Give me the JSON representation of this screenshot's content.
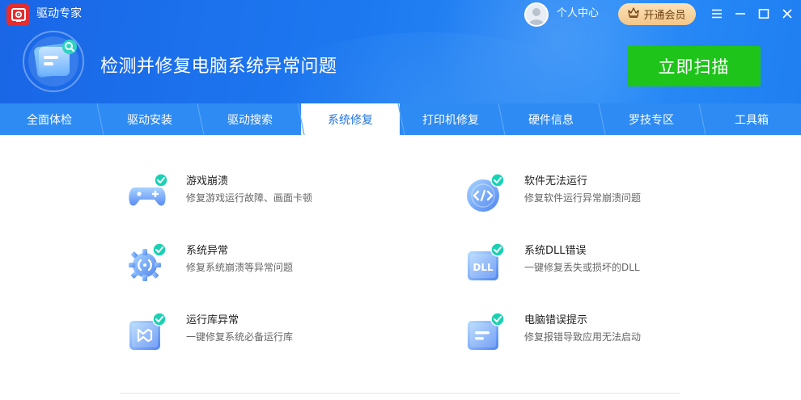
{
  "app": {
    "title": "驱动专家"
  },
  "header": {
    "user_center": "个人中心",
    "vip_label": "开通会员",
    "hero_title": "检测并修复电脑系统异常问题",
    "scan_button": "立即扫描"
  },
  "window_controls": [
    "menu-icon",
    "minimize-icon",
    "maximize-icon",
    "close-icon"
  ],
  "tabs": [
    {
      "label": "全面体检"
    },
    {
      "label": "驱动安装"
    },
    {
      "label": "驱动搜索"
    },
    {
      "label": "系统修复",
      "active": true
    },
    {
      "label": "打印机修复"
    },
    {
      "label": "硬件信息"
    },
    {
      "label": "罗技专区"
    },
    {
      "label": "工具箱"
    }
  ],
  "repair_items": [
    {
      "title": "游戏崩溃",
      "desc": "修复游戏运行故障、画面卡顿",
      "icon": "gamepad-icon"
    },
    {
      "title": "软件无法运行",
      "desc": "修复软件运行异常崩溃问题",
      "icon": "code-icon"
    },
    {
      "title": "系统异常",
      "desc": "修复系统崩溃等异常问题",
      "icon": "system-gear-icon"
    },
    {
      "title": "系统DLL错误",
      "desc": "一键修复丢失或损坏的DLL",
      "icon": "dll-icon"
    },
    {
      "title": "运行库异常",
      "desc": "一键修复系统必备运行库",
      "icon": "runtime-library-icon"
    },
    {
      "title": "电脑错误提示",
      "desc": "修复报错导致应用无法启动",
      "icon": "error-prompt-icon"
    }
  ],
  "colors": {
    "header_blue": "#1d79f0",
    "tab_blue": "#2e8bf3",
    "scan_green": "#1ec41a",
    "check_teal": "#19d2b4",
    "vip_gold": "#f3c68a"
  }
}
